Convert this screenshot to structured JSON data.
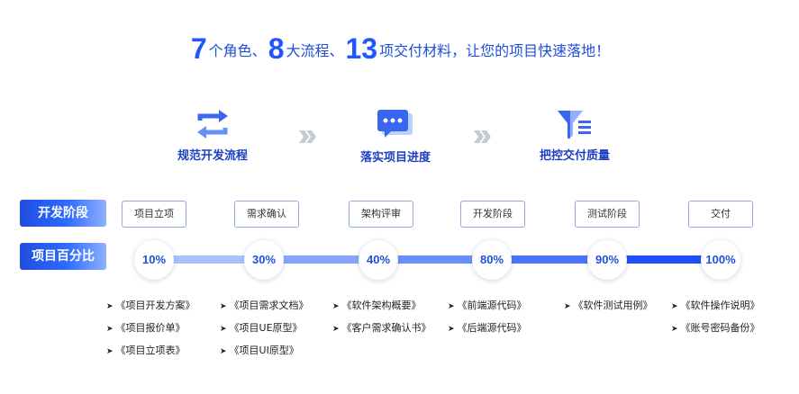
{
  "headline": {
    "n1": "7",
    "t1": "个角色、",
    "n2": "8",
    "t2": "大流程、",
    "n3": "13",
    "t3": "项交付材料，让您的项目快速落地！"
  },
  "features": [
    {
      "label": "规范开发流程",
      "icon": "cycle-arrows-icon"
    },
    {
      "label": "落实项目进度",
      "icon": "chat-bubble-icon"
    },
    {
      "label": "把控交付质量",
      "icon": "funnel-filter-icon"
    }
  ],
  "rows": {
    "stage_label": "开发阶段",
    "percent_label": "项目百分比"
  },
  "stages": [
    "项目立项",
    "需求确认",
    "架构评审",
    "开发阶段",
    "测试阶段",
    "交付"
  ],
  "percents": [
    "10%",
    "30%",
    "40%",
    "80%",
    "90%",
    "100%"
  ],
  "deliverables": [
    [
      "《项目开发方案》",
      "《项目报价单》",
      "《项目立项表》"
    ],
    [
      "《项目需求文档》",
      "《项目UE原型》",
      "《项目UI原型》"
    ],
    [
      "《软件架构概要》",
      "《客户需求确认书》"
    ],
    [
      "《前端源代码》",
      "《后端源代码》"
    ],
    [
      "《软件测试用例》"
    ],
    [
      "《软件操作说明》",
      "《账号密码备份》"
    ]
  ],
  "colors": {
    "accent": "#1f56ff",
    "accent_dark": "#1d3fc4",
    "chevron": "#c7cbd3"
  }
}
